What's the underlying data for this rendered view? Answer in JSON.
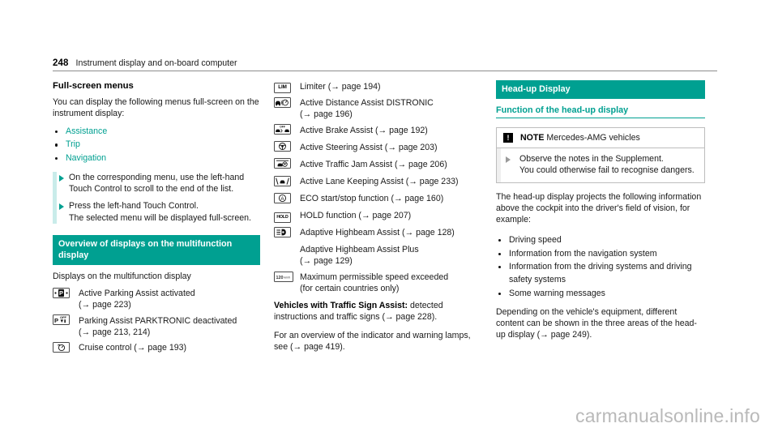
{
  "header": {
    "page_number": "248",
    "title": "Instrument display and on-board computer"
  },
  "left_column": {
    "heading": "Full-screen menus",
    "intro": "You can display the following menus full-screen on the instrument display:",
    "menu_items": [
      {
        "label": "Assistance"
      },
      {
        "label": "Trip"
      },
      {
        "label": "Navigation"
      }
    ],
    "steps": [
      {
        "text": "On the corresponding menu, use the left-hand Touch Control to scroll to the end of the list."
      },
      {
        "text": "Press the left-hand Touch Control.\nThe selected menu will be displayed full-screen."
      }
    ],
    "banner": "Overview of displays on the multifunction display",
    "subintro": "Displays on the multifunction display",
    "icon_rows": [
      {
        "icon": "parking-assist-p-icon",
        "icon_label": "P",
        "text": "Active Parking Assist activated\n(→ page 223)"
      },
      {
        "icon": "parktronic-off-icon",
        "icon_label": "P",
        "text": "Parking Assist PARKTRONIC deactivated\n(→ page 213, 214)"
      },
      {
        "icon": "cruise-control-icon",
        "icon_label": "",
        "text": "Cruise control (→ page 193)"
      }
    ]
  },
  "middle_column": {
    "icon_rows": [
      {
        "icon": "limiter-icon",
        "icon_label": "LIM",
        "text": "Limiter (→ page 194)"
      },
      {
        "icon": "distronic-icon",
        "icon_label": "",
        "text": "Active Distance Assist DISTRONIC\n(→ page 196)"
      },
      {
        "icon": "brake-assist-off-icon",
        "icon_label": "OFF",
        "text": "Active Brake Assist (→ page 192)"
      },
      {
        "icon": "steering-assist-icon",
        "icon_label": "",
        "text": "Active Steering Assist (→ page 203)"
      },
      {
        "icon": "traffic-jam-assist-icon",
        "icon_label": "",
        "text": "Active Traffic Jam Assist (→ page 206)"
      },
      {
        "icon": "lane-keeping-assist-icon",
        "icon_label": "",
        "text": "Active Lane Keeping Assist (→ page 233)"
      },
      {
        "icon": "eco-start-stop-icon",
        "icon_label": "A",
        "text": "ECO start/stop function (→ page 160)"
      },
      {
        "icon": "hold-function-icon",
        "icon_label": "HOLD",
        "text": "HOLD function (→ page 207)"
      },
      {
        "icon": "adaptive-highbeam-icon",
        "icon_label": "",
        "text": "Adaptive Highbeam Assist (→ page 128)"
      },
      {
        "icon": "none",
        "icon_label": "",
        "text": "Adaptive Highbeam Assist Plus\n(→ page 129)"
      },
      {
        "icon": "speed-limit-exceeded-icon",
        "icon_label": "120 km/h",
        "text": "Maximum permissible speed exceeded\n(for certain countries only)"
      }
    ],
    "traffic_sign_lead": "Vehicles with Traffic Sign Assist:",
    "traffic_sign_rest": " detected instructions and traffic signs (→ page 228).",
    "lamps_note": "For an overview of the indicator and warning lamps, see (→ page 419)."
  },
  "right_column": {
    "banner": "Head-up Display",
    "subheading": "Function of the head-up display",
    "note": {
      "symbol": "!",
      "title_bold": "NOTE",
      "title_rest": " Mercedes-AMG vehicles",
      "body": "Observe the notes in the Supplement.\nYou could otherwise fail to recognise dangers."
    },
    "intro": "The head-up display projects the following information above the cockpit into the driver's field of vision, for example:",
    "bullets": [
      {
        "label": "Driving speed"
      },
      {
        "label": "Information from the navigation system"
      },
      {
        "label": "Information from the driving systems and driving safety systems"
      },
      {
        "label": "Some warning messages"
      }
    ],
    "outro": "Depending on the vehicle's equipment, different content can be shown in the three areas of the head-up display (→ page 249)."
  },
  "watermark": "carmanualsonline.info",
  "colors": {
    "teal": "#00a091",
    "teal_light": "#c9ecea",
    "rule": "#8d8d8d"
  }
}
